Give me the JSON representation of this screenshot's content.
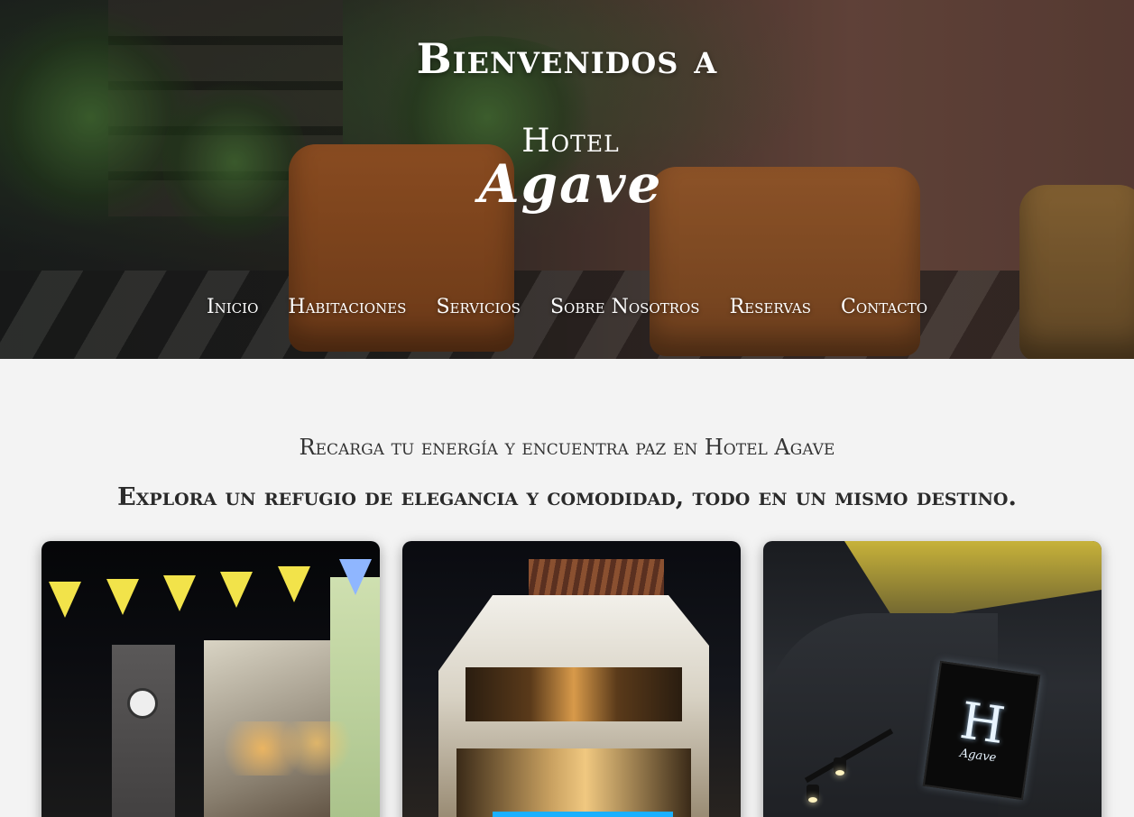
{
  "hero": {
    "title": "Bienvenidos a",
    "logo": {
      "line1": "Hotel",
      "line2": "Agave"
    }
  },
  "nav": {
    "items": [
      {
        "label": "Inicio"
      },
      {
        "label": "Habitaciones"
      },
      {
        "label": "Servicios"
      },
      {
        "label": "Sobre Nosotros"
      },
      {
        "label": "Reservas"
      },
      {
        "label": "Contacto"
      }
    ]
  },
  "main": {
    "tagline": "Recarga tu energía y encuentra paz en Hotel Agave",
    "heading": "Explora un refugio de elegancia y comodidad, todo en un mismo destino."
  },
  "cards": [
    {
      "image": "street-night-clock-tower"
    },
    {
      "image": "hotel-facade-night"
    },
    {
      "image": "hotel-sign",
      "sign_letter": "H",
      "sign_text": "Agave"
    }
  ],
  "colors": {
    "page_background": "#f3f3f3",
    "text": "#2a2a2a",
    "hero_text": "#ffffff"
  }
}
